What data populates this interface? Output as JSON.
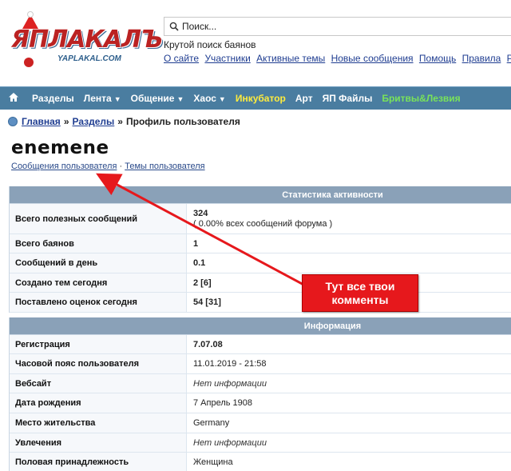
{
  "logo": {
    "main": "ЯПЛАКАЛЪ",
    "sub": "YAPLAKAL.COM"
  },
  "search": {
    "placeholder": "Поиск..."
  },
  "tagline": "Крутой поиск баянов",
  "toplinks": [
    "О сайте",
    "Участники",
    "Активные темы",
    "Новые сообщения",
    "Помощь",
    "Правила",
    "Р"
  ],
  "nav": {
    "items": [
      {
        "label": "Разделы",
        "caret": false,
        "style": "normal"
      },
      {
        "label": "Лента",
        "caret": true,
        "style": "normal"
      },
      {
        "label": "Общение",
        "caret": true,
        "style": "normal"
      },
      {
        "label": "Хаос",
        "caret": true,
        "style": "normal"
      },
      {
        "label": "Инкубатор",
        "caret": false,
        "style": "yellow"
      },
      {
        "label": "Арт",
        "caret": false,
        "style": "normal"
      },
      {
        "label": "ЯП Файлы",
        "caret": false,
        "style": "normal"
      },
      {
        "label": "Бритвы&Лезвия",
        "caret": false,
        "style": "green"
      }
    ]
  },
  "breadcrumb": {
    "home": "Главная",
    "sections": "Разделы",
    "current": "Профиль пользователя"
  },
  "profile": {
    "username": "enemene",
    "messages_link": "Сообщения пользователя",
    "dot": "·",
    "topics_link": "Темы пользователя"
  },
  "stats": {
    "title": "Статистика активности",
    "rows": [
      {
        "label": "Всего полезных сообщений",
        "value": "324",
        "sub": "( 0.00% всех сообщений форума )"
      },
      {
        "label": "Всего баянов",
        "value": "1"
      },
      {
        "label": "Сообщений в день",
        "value": "0.1"
      },
      {
        "label": "Создано тем сегодня",
        "value": "2 [6]"
      },
      {
        "label": "Поставлено оценок сегодня",
        "value": "54 [31]"
      }
    ]
  },
  "info": {
    "title": "Информация",
    "rows": [
      {
        "label": "Регистрация",
        "value": "7.07.08",
        "style": "bold"
      },
      {
        "label": "Часовой пояс пользователя",
        "value": "11.01.2019 - 21:58",
        "style": "normal"
      },
      {
        "label": "Вебсайт",
        "value": "Нет информации",
        "style": "italic"
      },
      {
        "label": "Дата рождения",
        "value": "7 Апрель 1908",
        "style": "normal"
      },
      {
        "label": "Место жительства",
        "value": "Germany",
        "style": "normal"
      },
      {
        "label": "Увлечения",
        "value": "Нет информации",
        "style": "italic"
      },
      {
        "label": "Половая принадлежность",
        "value": "Женщина",
        "style": "normal"
      }
    ]
  },
  "annotation": {
    "line1": "Тут все твои",
    "line2": "комменты",
    "color": "#e6181c"
  }
}
